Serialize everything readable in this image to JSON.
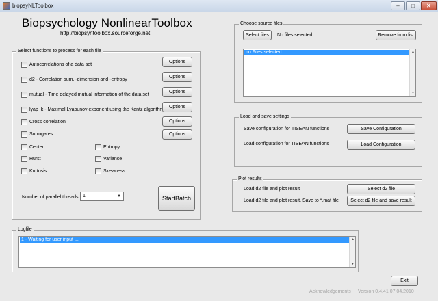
{
  "window": {
    "title": "biopsyNLToolbox",
    "min_glyph": "–",
    "max_glyph": "□",
    "close_glyph": "✕"
  },
  "header": {
    "title": "Biopsychology NonlinearToolbox",
    "url": "http://biopsyntoolbox.sourceforge.net"
  },
  "functions_panel": {
    "title": "Select functions to process for each file",
    "items": [
      {
        "label": "Autocorrelations of a data set",
        "options": "Options"
      },
      {
        "label": "d2 - Correlation sum, -dimension and -entropy",
        "options": "Options"
      },
      {
        "label": "mutual - Time delayed mutual information of the data set",
        "options": "Options"
      },
      {
        "label": "lyap_k - Maximal Lyapunov exponent using the Kantz algorithm",
        "options": "Options"
      },
      {
        "label": "Cross correlation",
        "options": "Options"
      },
      {
        "label": "Surrogates",
        "options": "Options"
      }
    ],
    "measures_left": [
      "Center",
      "Hurst",
      "Kurtosis"
    ],
    "measures_right": [
      "Entropy",
      "Variance",
      "Skewness"
    ],
    "threads_label": "Number of parallel threads",
    "threads_value": "1",
    "start_label": "StartBatch"
  },
  "source_panel": {
    "title": "Choose source files",
    "select_label": "Select files",
    "status": "No files selected.",
    "remove_label": "Remove from list",
    "list_item": "no Files selected"
  },
  "settings_panel": {
    "title": "Load and save settings",
    "rows": [
      {
        "label": "Save configuration for TISEAN functions",
        "button": "Save Configuration"
      },
      {
        "label": "Load configuration for TISEAN functions",
        "button": "Load  Configuration"
      }
    ]
  },
  "plot_panel": {
    "title": "Plot results",
    "rows": [
      {
        "label": "Load d2 file and plot result",
        "button": "Select d2 file"
      },
      {
        "label": "Load d2 file and plot result. Save to *.mat file",
        "button": "Select d2 file and save result"
      }
    ]
  },
  "log_panel": {
    "title": "Logfile",
    "entry": "1 - Waiting for user input ..."
  },
  "footer": {
    "exit_label": "Exit",
    "ack": "Acknowledgements",
    "version": "Version 0.4.41 07.04.2010"
  }
}
